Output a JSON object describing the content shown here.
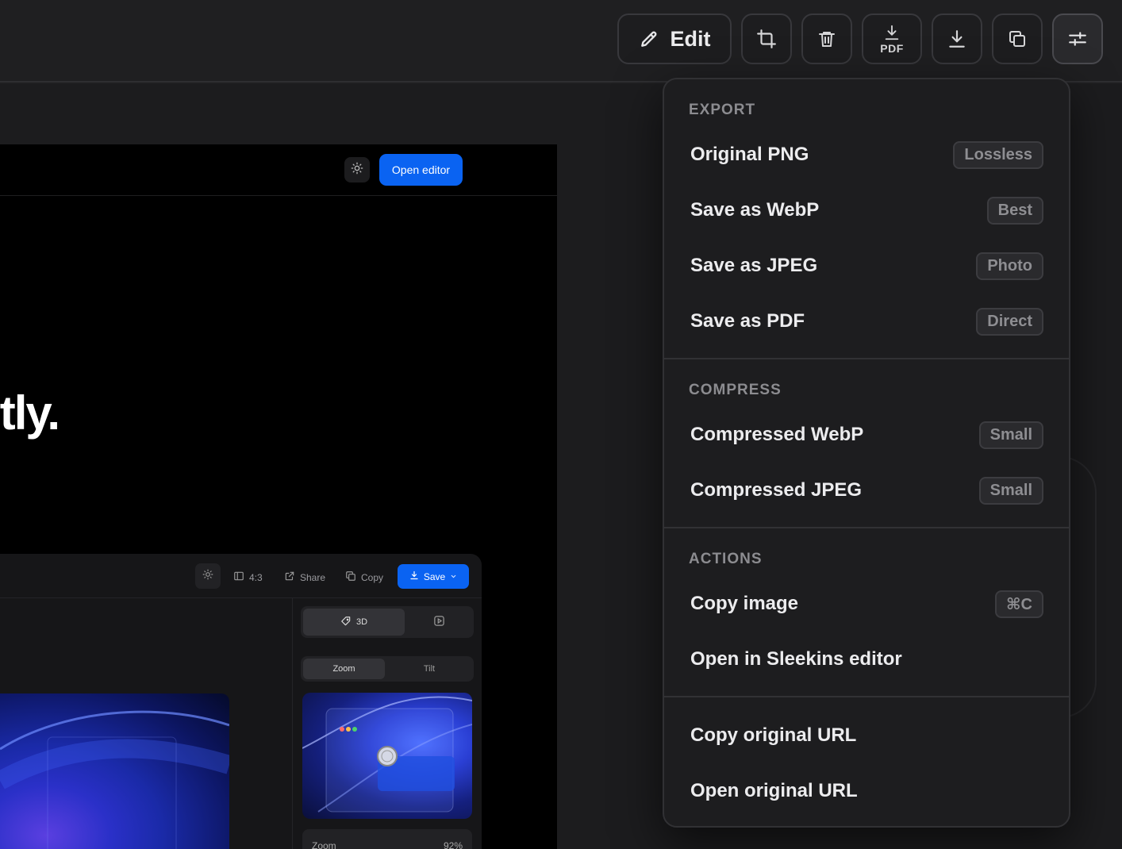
{
  "toolbar": {
    "edit_label": "Edit",
    "pdf_label": "PDF",
    "buttons": [
      "edit",
      "crop",
      "delete",
      "download-pdf",
      "download",
      "copy",
      "adjust"
    ]
  },
  "preview": {
    "open_editor_label": "Open editor",
    "hero_text": "tly.",
    "inner_app": {
      "aspect_label": "4:3",
      "share_label": "Share",
      "copy_label": "Copy",
      "save_label": "Save",
      "tab_3d_label": "3D",
      "zoom_tab_label": "Zoom",
      "tilt_tab_label": "Tilt",
      "zoom_row_label": "Zoom",
      "zoom_value": "92%"
    }
  },
  "menu": {
    "export": {
      "title": "EXPORT",
      "items": [
        {
          "label": "Original PNG",
          "badge": "Lossless"
        },
        {
          "label": "Save as WebP",
          "badge": "Best"
        },
        {
          "label": "Save as JPEG",
          "badge": "Photo"
        },
        {
          "label": "Save as PDF",
          "badge": "Direct"
        }
      ]
    },
    "compress": {
      "title": "COMPRESS",
      "items": [
        {
          "label": "Compressed WebP",
          "badge": "Small"
        },
        {
          "label": "Compressed JPEG",
          "badge": "Small"
        }
      ]
    },
    "actions": {
      "title": "ACTIONS",
      "items": [
        {
          "label": "Copy image",
          "badge": "⌘C"
        },
        {
          "label": "Open in Sleekins editor"
        }
      ]
    },
    "urls": {
      "items": [
        {
          "label": "Copy original URL"
        },
        {
          "label": "Open original URL"
        }
      ]
    }
  },
  "colors": {
    "accent": "#0a63f2",
    "background": "#1f1f21",
    "menu_bg": "#1d1d1f"
  }
}
